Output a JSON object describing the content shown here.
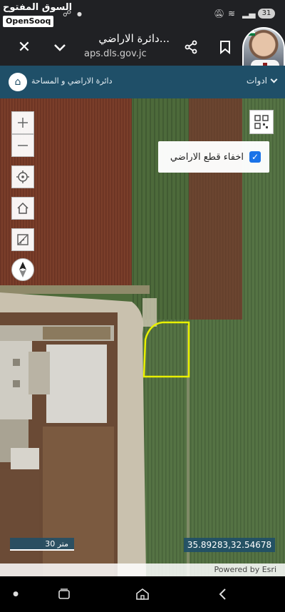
{
  "watermark": {
    "arabic": "السوق المفتوح",
    "english": "OpenSooq"
  },
  "status": {
    "battery": "31"
  },
  "browser": {
    "page_title": "دائرة الاراضي...",
    "url": "aps.dls.gov.jc"
  },
  "site": {
    "name": "دائرة الاراضي و المساحة",
    "tools_label": "ادوات"
  },
  "map": {
    "hide_parcels_label": "اخفاء قطع الاراضي",
    "hide_parcels_checked": true,
    "scale_label": "30 متر",
    "coordinates": "35.89283,32.54678",
    "attribution": "Powered by Esri",
    "parcel_outline_color": "#e8f000"
  },
  "icons": {
    "close": "close-icon",
    "chevron": "chevron-down-icon",
    "share": "share-icon",
    "bookmark": "bookmark-icon",
    "zoom_in": "plus-icon",
    "zoom_out": "minus-icon",
    "locate": "crosshair-icon",
    "home": "home-icon",
    "measure": "measure-icon",
    "compass": "compass-icon",
    "qr": "qr-code-icon"
  }
}
